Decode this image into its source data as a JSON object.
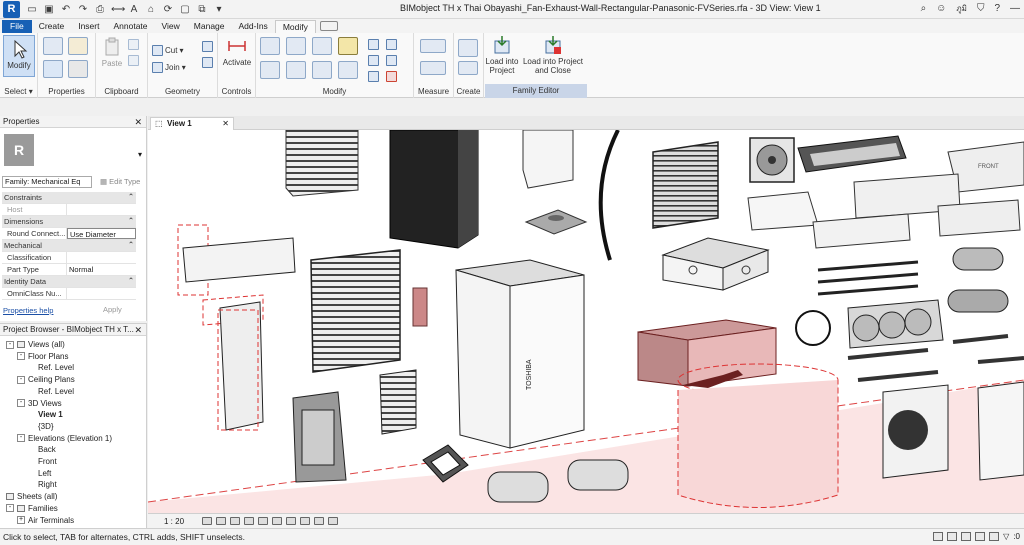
{
  "app": {
    "logo": "R",
    "title": "BIMobject TH x Thai Obayashi_Fan-Exhaust-Wall-Rectangular-Panasonic-FVSeries.rfa - 3D View: View 1",
    "user": "ภูมิ"
  },
  "tabs": [
    "File",
    "Create",
    "Insert",
    "Annotate",
    "View",
    "Manage",
    "Add-Ins",
    "Modify"
  ],
  "active_tab": "Modify",
  "ribbon": {
    "modify_label": "Modify",
    "cut_label": "Cut",
    "join_label": "Join",
    "paste_label": "Paste",
    "activate_label": "Activate",
    "load_project_label": "Load into Project",
    "load_close_label": "Load into Project and Close",
    "panels": {
      "select": "Select",
      "properties": "Properties",
      "clipboard": "Clipboard",
      "geometry": "Geometry",
      "controls": "Controls",
      "modify": "Modify",
      "measure": "Measure",
      "create": "Create",
      "family_editor": "Family Editor"
    }
  },
  "properties": {
    "header": "Properties",
    "family": "Family: Mechanical Eq",
    "edit_type": "Edit Type",
    "rows": [
      {
        "type": "section",
        "label": "Constraints"
      },
      {
        "type": "row",
        "k": "Host",
        "v": "",
        "gray": true
      },
      {
        "type": "section",
        "label": "Dimensions"
      },
      {
        "type": "row",
        "k": "Round Connect...",
        "v": "Use Diameter",
        "box": true
      },
      {
        "type": "section",
        "label": "Mechanical"
      },
      {
        "type": "row",
        "k": "Classification",
        "v": ""
      },
      {
        "type": "row",
        "k": "Part Type",
        "v": "Normal"
      },
      {
        "type": "section",
        "label": "Identity Data"
      },
      {
        "type": "row",
        "k": "OmniClass Nu...",
        "v": ""
      }
    ],
    "help": "Properties help",
    "apply": "Apply"
  },
  "browser": {
    "header": "Project Browser - BIMobject TH x T...",
    "items": [
      {
        "label": "Views (all)",
        "level": 0,
        "toggle": "-",
        "bold": false
      },
      {
        "label": "Floor Plans",
        "level": 1,
        "toggle": "-"
      },
      {
        "label": "Ref. Level",
        "level": 2,
        "toggle": ""
      },
      {
        "label": "Ceiling Plans",
        "level": 1,
        "toggle": "-"
      },
      {
        "label": "Ref. Level",
        "level": 2,
        "toggle": ""
      },
      {
        "label": "3D Views",
        "level": 1,
        "toggle": "-"
      },
      {
        "label": "View 1",
        "level": 2,
        "toggle": "",
        "bold": true
      },
      {
        "label": "{3D}",
        "level": 2,
        "toggle": ""
      },
      {
        "label": "Elevations (Elevation 1)",
        "level": 1,
        "toggle": "-"
      },
      {
        "label": "Back",
        "level": 2,
        "toggle": ""
      },
      {
        "label": "Front",
        "level": 2,
        "toggle": ""
      },
      {
        "label": "Left",
        "level": 2,
        "toggle": ""
      },
      {
        "label": "Right",
        "level": 2,
        "toggle": ""
      },
      {
        "label": "Sheets (all)",
        "level": 0,
        "toggle": ""
      },
      {
        "label": "Families",
        "level": 0,
        "toggle": "-"
      },
      {
        "label": "Air Terminals",
        "level": 1,
        "toggle": "+"
      }
    ]
  },
  "view": {
    "tab_label": "View 1",
    "scale": "1 : 20",
    "unit_brand_label": "TOSHIBA",
    "front_label": "FRONT"
  },
  "status": {
    "text": "Click to select, TAB for alternates, CTRL adds, SHIFT unselects.",
    "filter_count": ":0"
  }
}
